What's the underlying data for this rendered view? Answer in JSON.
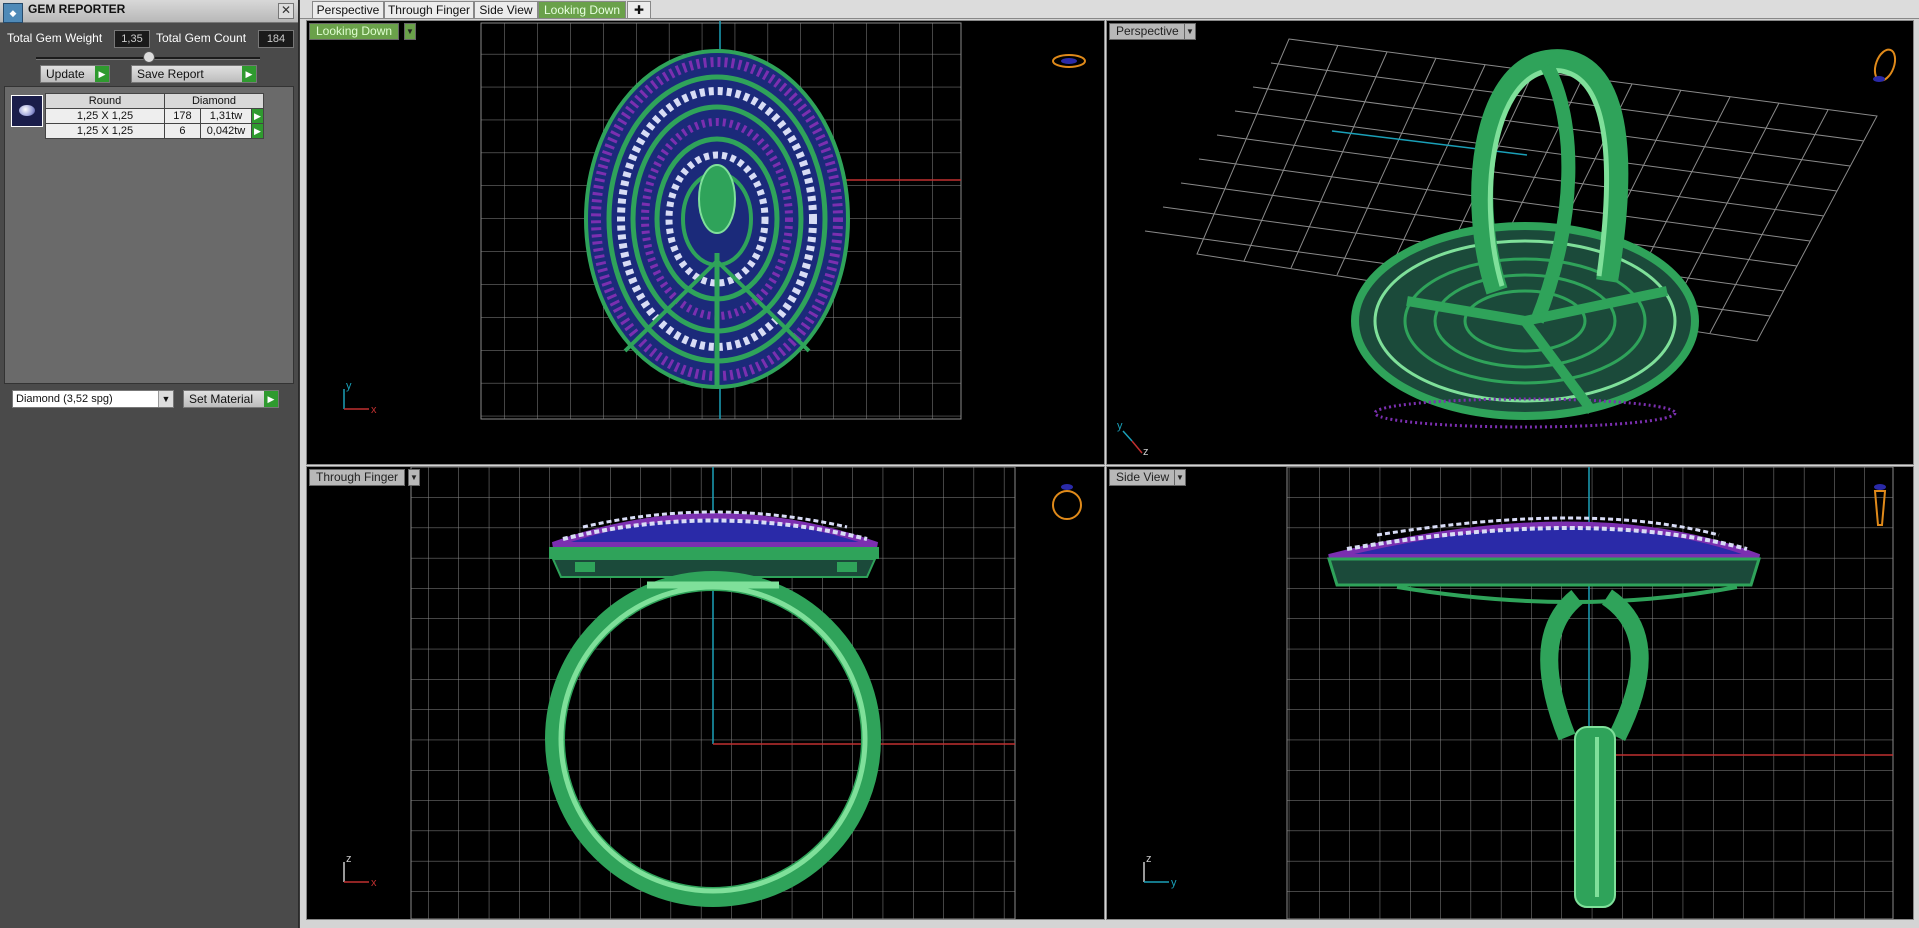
{
  "panel": {
    "title": "GEM REPORTER",
    "total_weight_label": "Total Gem Weight",
    "total_weight_value": "1,35",
    "total_count_label": "Total Gem Count",
    "total_count_value": "184",
    "update_label": "Update",
    "save_report_label": "Save Report",
    "table": {
      "headers": [
        "Round",
        "Diamond"
      ],
      "rows": [
        {
          "size": "1,25 X 1,25",
          "count": "178",
          "weight": "1,31tw"
        },
        {
          "size": "1,25 X 1,25",
          "count": "6",
          "weight": "0,042tw"
        }
      ]
    },
    "material_value": "Diamond    (3,52 spg)",
    "set_material_label": "Set Material"
  },
  "tabs": [
    {
      "label": "Perspective",
      "active": false
    },
    {
      "label": "Through Finger",
      "active": false
    },
    {
      "label": "Side View",
      "active": false
    },
    {
      "label": "Looking Down",
      "active": true
    }
  ],
  "viewports": {
    "top_left": {
      "label": "Looking Down",
      "axis_v": "y",
      "axis_h": "x"
    },
    "top_right": {
      "label": "Perspective",
      "axis_v": "y",
      "axis_h": "z"
    },
    "bottom_left": {
      "label": "Through Finger",
      "axis_v": "z",
      "axis_h": "x"
    },
    "bottom_right": {
      "label": "Side View",
      "axis_v": "z",
      "axis_h": "y"
    }
  },
  "colors": {
    "metal": "#2fa35a",
    "metal_light": "#7fe09a",
    "gem_white": "#d8dcf5",
    "gem_purple": "#7b2fb0",
    "gem_blue": "#2a2aa8",
    "grid": "#8a8a8a",
    "axis_red": "#c03030",
    "axis_cyan": "#1aa0b8",
    "accent_green": "#6aa14a"
  }
}
